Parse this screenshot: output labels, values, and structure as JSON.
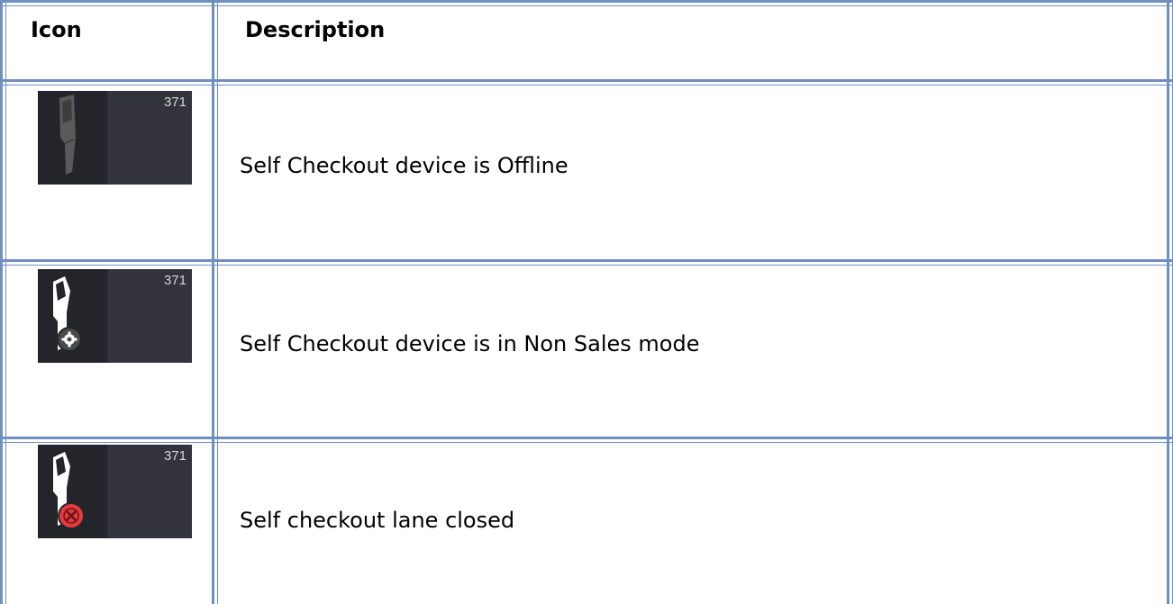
{
  "table": {
    "headers": {
      "icon": "Icon",
      "description": "Description"
    },
    "rows": [
      {
        "icon": "self-checkout-offline-icon",
        "tile_number": "371",
        "description": "Self Checkout device is Offline"
      },
      {
        "icon": "self-checkout-non-sales-icon",
        "tile_number": "371",
        "description": "Self Checkout device is in Non Sales mode"
      },
      {
        "icon": "self-checkout-lane-closed-icon",
        "tile_number": "371",
        "description": "Self checkout lane closed"
      }
    ]
  },
  "colors": {
    "border": "#6f8fbf",
    "tile_background": "#32333b",
    "tile_left_panel": "#24252b",
    "offline_device": "#5a5a5a",
    "active_device": "#ffffff",
    "gear_badge": "#4a4a4a",
    "closed_badge": "#e5393e"
  }
}
